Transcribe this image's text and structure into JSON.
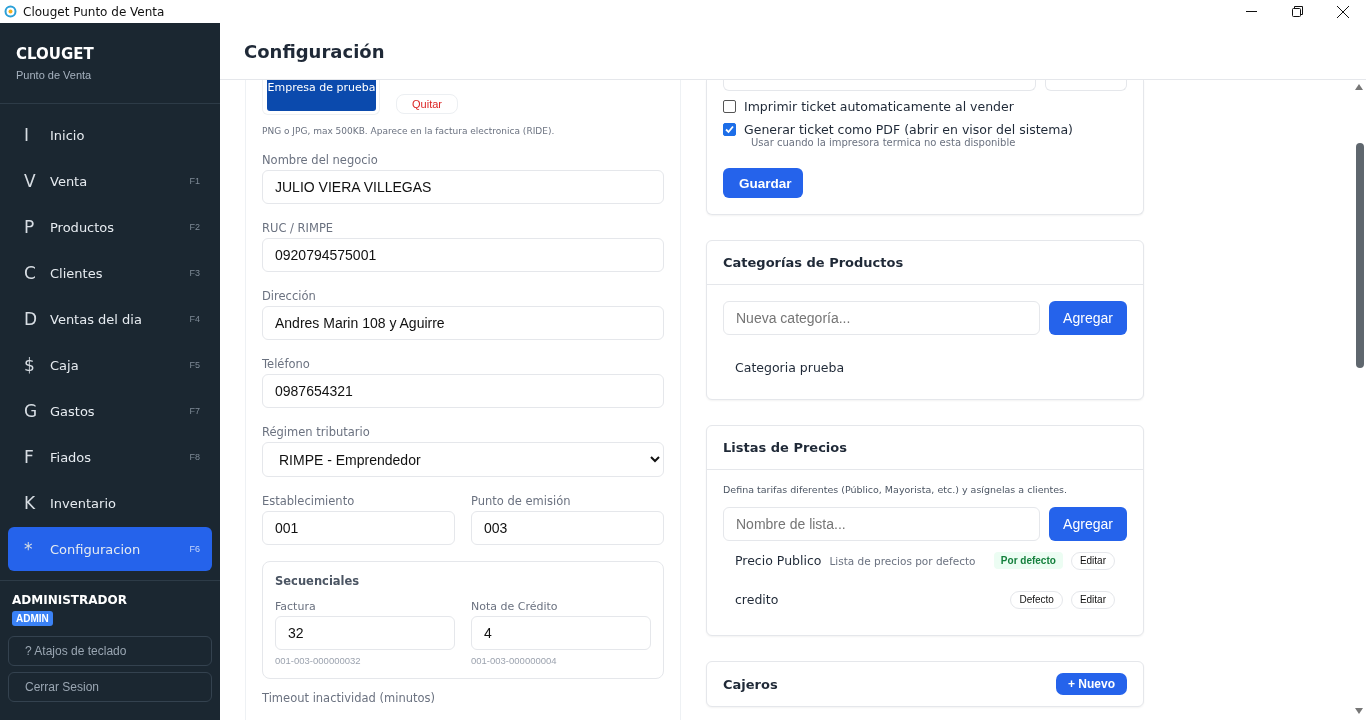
{
  "window": {
    "title": "Clouget Punto de Venta"
  },
  "sidebar": {
    "brand": "CLOUGET",
    "subtitle": "Punto de Venta",
    "items": [
      {
        "icon": "I",
        "label": "Inicio",
        "selected": false
      },
      {
        "icon": "V",
        "label": "Venta",
        "key": "F1",
        "selected": false
      },
      {
        "icon": "P",
        "label": "Productos",
        "key": "F2",
        "selected": false
      },
      {
        "icon": "C",
        "label": "Clientes",
        "key": "F3",
        "selected": false
      },
      {
        "icon": "D",
        "label": "Ventas del dia",
        "key": "F4",
        "selected": false
      },
      {
        "icon": "$",
        "label": "Caja",
        "key": "F5",
        "selected": false
      },
      {
        "icon": "G",
        "label": "Gastos",
        "key": "F7",
        "selected": false
      },
      {
        "icon": "F",
        "label": "Fiados",
        "key": "F8",
        "selected": false
      },
      {
        "icon": "K",
        "label": "Inventario",
        "selected": false
      },
      {
        "icon": "*",
        "label": "Configuracion",
        "key": "F6",
        "selected": true
      }
    ],
    "user": "ADMINISTRADOR",
    "role": "ADMIN",
    "shortcuts_button": "? Atajos de teclado",
    "logout_button": "Cerrar Sesion"
  },
  "header": {
    "title": "Configuración"
  },
  "business": {
    "logo_text": "Empresa de prueba",
    "remove_button": "Quitar",
    "logo_hint": "PNG o JPG, max 500KB. Aparece en la factura electronica (RIDE).",
    "fields": [
      {
        "label": "Nombre del negocio",
        "value": "JULIO VIERA VILLEGAS"
      },
      {
        "label": "RUC / RIMPE",
        "value": "0920794575001"
      },
      {
        "label": "Dirección",
        "value": "Andres Marin 108 y Aguirre"
      },
      {
        "label": "Teléfono",
        "value": "0987654321"
      }
    ],
    "regime": {
      "label": "Régimen tributario",
      "value": "RIMPE - Emprendedor"
    },
    "establishment": {
      "label": "Establecimiento",
      "value": "001"
    },
    "emission_point": {
      "label": "Punto de emisión",
      "value": "003"
    },
    "sequentials": {
      "title": "Secuenciales",
      "items": [
        {
          "label": "Factura",
          "value": "32",
          "formatted": "001-003-000000032"
        },
        {
          "label": "Nota de Crédito",
          "value": "4",
          "formatted": "001-003-000000004"
        }
      ]
    },
    "timeout_label": "Timeout inactividad (minutos)"
  },
  "printing": {
    "options": [
      {
        "label": "Imprimir ticket automaticamente al vender",
        "checked": false
      },
      {
        "label": "Generar ticket como PDF (abrir en visor del sistema)",
        "checked": true,
        "hint": "Usar cuando la impresora termica no esta disponible"
      }
    ],
    "save_button": "Guardar"
  },
  "categories": {
    "title": "Categorías de Productos",
    "placeholder": "Nueva categoría...",
    "add_button": "Agregar",
    "items": [
      "Categoria prueba"
    ]
  },
  "price_lists": {
    "title": "Listas de Precios",
    "description": "Defina tarifas diferentes (Público, Mayorista, etc.) y asígnelas a clientes.",
    "placeholder": "Nombre de lista...",
    "add_button": "Agregar",
    "items": [
      {
        "name": "Precio Publico",
        "description": "Lista de precios por defecto",
        "is_default": true,
        "default_badge": "Por defecto",
        "edit_button": "Editar"
      },
      {
        "name": "credito",
        "is_default": false,
        "default_button": "Defecto",
        "edit_button": "Editar"
      }
    ]
  },
  "cashiers": {
    "title": "Cajeros",
    "new_button": "+ Nuevo"
  }
}
